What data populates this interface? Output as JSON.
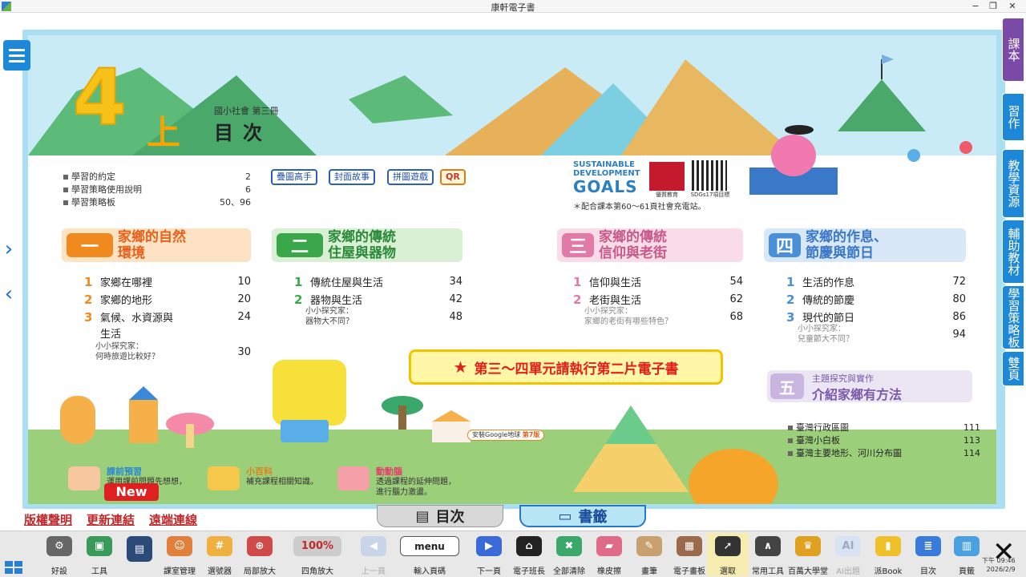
{
  "window": {
    "title": "康軒電子書",
    "min": "−",
    "restore": "❐",
    "close": "✕"
  },
  "cover": {
    "grade": "4",
    "term": "上",
    "subtitle": "國小社會 第三冊",
    "heading": "目次"
  },
  "intro_items": [
    {
      "label": "學習的約定",
      "page": "2"
    },
    {
      "label": "學習策略使用說明",
      "page": "6"
    },
    {
      "label": "學習策略板",
      "page": "50、96"
    }
  ],
  "chips": [
    "疊圖高手",
    "封面故事",
    "拼圖遊戲",
    "QR"
  ],
  "sdg": {
    "line1": "SUSTAINABLE",
    "line2": "DEVELOPMENT",
    "goals": "GOALS",
    "badge_caption": "優質教育",
    "qr_caption": "SDGs17項目標",
    "note": "＊配合課本第60～61頁社會充電站。"
  },
  "units": [
    {
      "num": "一",
      "title1": "家鄉的自然",
      "title2": "環境",
      "color": "#f08a1e",
      "bg": "#fde3c4",
      "lessons": [
        {
          "n": "1",
          "title": "家鄉在哪裡",
          "page": "10"
        },
        {
          "n": "2",
          "title": "家鄉的地形",
          "page": "20"
        },
        {
          "n": "3",
          "title": "氣候、水資源與",
          "title_b": "生活",
          "page": "24"
        }
      ],
      "explore_label": "小小探究家：",
      "explore_text": "何時旅遊比較好？",
      "explore_page": "30"
    },
    {
      "num": "二",
      "title1": "家鄉的傳統",
      "title2": "住屋與器物",
      "color": "#3aa84a",
      "bg": "#d9f0d4",
      "lessons": [
        {
          "n": "1",
          "title": "傳統住屋與生活",
          "page": "34"
        },
        {
          "n": "2",
          "title": "器物與生活",
          "page": "42"
        }
      ],
      "explore_label": "小小探究家：",
      "explore_text": "器物大不同？",
      "explore_page": "48"
    },
    {
      "num": "三",
      "title1": "家鄉的傳統",
      "title2": "信仰與老街",
      "color": "#e27aa8",
      "bg": "#f9dce8",
      "lessons": [
        {
          "n": "1",
          "title": "信仰與生活",
          "page": "54"
        },
        {
          "n": "2",
          "title": "老街與生活",
          "page": "62"
        }
      ],
      "explore_label": "小小探究家：",
      "explore_text": "家鄉的老街有哪些特色？",
      "explore_page": "68"
    },
    {
      "num": "四",
      "title1": "家鄉的作息、",
      "title2": "節慶與節日",
      "color": "#4a90d8",
      "bg": "#d8e8f8",
      "lessons": [
        {
          "n": "1",
          "title": "生活的作息",
          "page": "72"
        },
        {
          "n": "2",
          "title": "傳統的節慶",
          "page": "80"
        },
        {
          "n": "3",
          "title": "現代的節日",
          "page": "86"
        }
      ],
      "explore_label": "小小探究家：",
      "explore_text": "兒童節大不同？",
      "explore_page": "94"
    }
  ],
  "banner": {
    "star": "★",
    "text": "第三～四單元請執行第二片電子書"
  },
  "unit5": {
    "num": "五",
    "caption": "主題探究與實作",
    "title": "介紹家鄉有方法"
  },
  "extra_items": [
    {
      "label": "臺灣行政區圖",
      "page": "111"
    },
    {
      "label": "臺灣小白板",
      "page": "113"
    },
    {
      "label": "臺灣主要地形、河川分布圖",
      "page": "114"
    }
  ],
  "google_tag": {
    "text": "安裝Google地球",
    "edition": "第7版"
  },
  "legend": [
    {
      "title": "課前預習",
      "line1": "運用課前問題先想想，",
      "line2": "。"
    },
    {
      "title": "小百科",
      "line1": "補充課程相關知識。",
      "line2": ""
    },
    {
      "title": "動動腦",
      "line1": "透過課程的延伸問題，",
      "line2": "進行腦力激盪。"
    }
  ],
  "links": [
    "版權聲明",
    "更新連結",
    "遠端連線"
  ],
  "new_badge": "New",
  "bottom_tabs": {
    "toc": "目次",
    "bookmark": "書籤"
  },
  "side_tabs": [
    {
      "label": "課本",
      "active": true
    },
    {
      "label": "習作",
      "active": false
    },
    {
      "label": "教學資源",
      "active": false
    },
    {
      "label": "輔助教材",
      "active": false
    },
    {
      "label": "學習策略板",
      "active": false
    },
    {
      "label": "雙頁",
      "active": false
    }
  ],
  "toolbar": [
    {
      "label": "好設",
      "icon": "gear-icon"
    },
    {
      "label": "工具",
      "icon": "toolbox-icon"
    },
    {
      "label": "",
      "icon": "save-icon"
    },
    {
      "label": "課室管理",
      "icon": "classroom-icon"
    },
    {
      "label": "選號器",
      "icon": "number-picker-icon"
    },
    {
      "label": "局部放大",
      "icon": "zoom-in-icon"
    },
    {
      "label": "四角放大",
      "icon": "zoom-percent-icon",
      "value": "100%"
    },
    {
      "label": "上一頁",
      "icon": "prev-page-icon",
      "disabled": true
    },
    {
      "label": "輸入頁碼",
      "icon": "menu-icon",
      "value": "menu"
    },
    {
      "label": "下一頁",
      "icon": "next-page-icon"
    },
    {
      "label": "電子班長",
      "icon": "graduation-cap-icon"
    },
    {
      "label": "全部清除",
      "icon": "trash-icon"
    },
    {
      "label": "橡皮擦",
      "icon": "eraser-icon"
    },
    {
      "label": "畫筆",
      "icon": "palette-icon"
    },
    {
      "label": "電子畫板",
      "icon": "easel-icon"
    },
    {
      "label": "選取",
      "icon": "cursor-icon",
      "selected": true
    },
    {
      "label": "常用工具",
      "icon": "compass-icon"
    },
    {
      "label": "百萬大學堂",
      "icon": "trophy-icon"
    },
    {
      "label": "AI出題",
      "icon": "ai-icon",
      "disabled": true
    },
    {
      "label": "派Book",
      "icon": "book-icon"
    },
    {
      "label": "目次",
      "icon": "toc-icon"
    },
    {
      "label": "頁籤",
      "icon": "tab-icon"
    }
  ],
  "clock": {
    "time": "下午 09:46",
    "date": "2026/2/9"
  }
}
